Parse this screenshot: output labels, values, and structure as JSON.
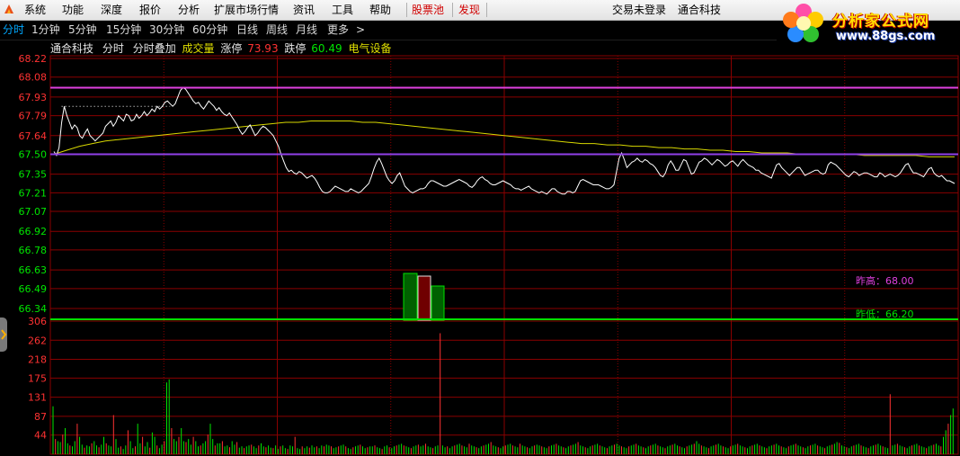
{
  "menubar": {
    "items": [
      "系统",
      "功能",
      "深度",
      "报价",
      "分析",
      "扩展市场行情",
      "资讯",
      "工具",
      "帮助"
    ],
    "highlight_items": [
      "股票池",
      "发现"
    ],
    "login_status": "交易未登录",
    "stock_title": "通合科技"
  },
  "brand": {
    "title": "分析家公式网",
    "url": "www.88gs.com"
  },
  "periodbar": {
    "items": [
      "分时",
      "1分钟",
      "5分钟",
      "15分钟",
      "30分钟",
      "60分钟",
      "日线",
      "周线",
      "月线",
      "更多"
    ],
    "active": "分时",
    "more_arrow": ">"
  },
  "infobar": {
    "stock_name": "通合科技",
    "mode": "分时",
    "overlay": "分时叠加",
    "volume_label": "成交量",
    "limit_up_label": "涨停",
    "limit_up_value": "73.93",
    "limit_down_label": "跌停",
    "limit_down_value": "60.49",
    "sector": "电气设备"
  },
  "colors": {
    "up": "#ff3232",
    "down": "#00e600",
    "grid": "#8a0000",
    "price_line": "#ffffff",
    "avg_line": "#d8d800",
    "prev_close": "#9040e8",
    "yesterday_high": "#e040e0",
    "yesterday_low": "#00e000",
    "accent": "#00a8ff"
  },
  "price_axis": {
    "ticks": [
      "68.22",
      "68.08",
      "67.93",
      "67.79",
      "67.64",
      "67.50",
      "67.35",
      "67.21",
      "67.07",
      "66.92",
      "66.78",
      "66.63",
      "66.49",
      "66.34"
    ],
    "up_ticks": 5,
    "prev_close": "67.50"
  },
  "volume_axis": {
    "ticks": [
      "306",
      "262",
      "218",
      "175",
      "131",
      "87",
      "44"
    ]
  },
  "reference_lines": {
    "yesterday_high_label": "昨高",
    "yesterday_high": "68.00",
    "yesterday_low_label": "昨低",
    "yesterday_low": "66.20"
  },
  "chart_data": {
    "type": "line",
    "prev_close": 67.5,
    "price_range": [
      66.34,
      68.22
    ],
    "volume_range": [
      0,
      306
    ],
    "price_series": [
      67.52,
      67.49,
      67.55,
      67.74,
      67.86,
      67.79,
      67.74,
      67.69,
      67.72,
      67.7,
      67.64,
      67.62,
      67.66,
      67.69,
      67.64,
      67.62,
      67.6,
      67.62,
      67.64,
      67.66,
      67.71,
      67.73,
      67.75,
      67.71,
      67.74,
      67.79,
      67.77,
      67.75,
      67.8,
      67.79,
      67.75,
      67.76,
      67.8,
      67.77,
      67.79,
      67.82,
      67.79,
      67.81,
      67.84,
      67.82,
      67.86,
      67.84,
      67.86,
      67.89,
      67.9,
      67.88,
      67.86,
      67.88,
      67.93,
      67.98,
      68.0,
      67.99,
      67.96,
      67.93,
      67.9,
      67.88,
      67.89,
      67.86,
      67.84,
      67.87,
      67.9,
      67.88,
      67.86,
      67.83,
      67.85,
      67.82,
      67.8,
      67.79,
      67.81,
      67.78,
      67.75,
      67.72,
      67.68,
      67.65,
      67.67,
      67.7,
      67.72,
      67.68,
      67.64,
      67.66,
      67.69,
      67.71,
      67.7,
      67.68,
      67.66,
      67.64,
      67.6,
      67.56,
      67.5,
      67.45,
      67.4,
      67.37,
      67.38,
      67.36,
      67.35,
      67.37,
      67.36,
      67.34,
      67.32,
      67.33,
      67.34,
      67.32,
      67.29,
      67.25,
      67.22,
      67.21,
      67.21,
      67.22,
      67.24,
      67.26,
      67.25,
      67.24,
      67.23,
      67.22,
      67.22,
      67.24,
      67.23,
      67.22,
      67.21,
      67.22,
      67.24,
      67.26,
      67.28,
      67.33,
      67.39,
      67.44,
      67.47,
      67.43,
      67.38,
      67.33,
      67.3,
      67.28,
      67.3,
      67.34,
      67.36,
      67.31,
      67.26,
      67.24,
      67.22,
      67.21,
      67.22,
      67.23,
      67.24,
      67.24,
      67.25,
      67.28,
      67.3,
      67.3,
      67.29,
      67.28,
      67.27,
      67.26,
      67.26,
      67.27,
      67.28,
      67.29,
      67.3,
      67.31,
      67.3,
      67.29,
      67.28,
      67.26,
      67.25,
      67.27,
      67.3,
      67.32,
      67.33,
      67.31,
      67.3,
      67.28,
      67.27,
      67.27,
      67.28,
      67.29,
      67.3,
      67.29,
      67.28,
      67.27,
      67.25,
      67.24,
      67.24,
      67.23,
      67.24,
      67.25,
      67.26,
      67.24,
      67.23,
      67.22,
      67.21,
      67.22,
      67.21,
      67.2,
      67.22,
      67.24,
      67.24,
      67.22,
      67.21,
      67.2,
      67.2,
      67.22,
      67.22,
      67.21,
      67.22,
      67.26,
      67.3,
      67.31,
      67.3,
      67.29,
      67.28,
      67.27,
      67.27,
      67.27,
      67.26,
      67.25,
      67.24,
      67.24,
      67.25,
      67.27,
      67.37,
      67.47,
      67.51,
      67.46,
      67.4,
      67.42,
      67.44,
      67.45,
      67.47,
      67.45,
      67.44,
      67.46,
      67.45,
      67.43,
      67.42,
      67.4,
      67.37,
      67.34,
      67.33,
      67.36,
      67.42,
      67.45,
      67.42,
      67.38,
      67.38,
      67.42,
      67.46,
      67.45,
      67.4,
      67.35,
      67.36,
      67.4,
      67.44,
      67.45,
      67.47,
      67.46,
      67.44,
      67.42,
      67.44,
      67.46,
      67.45,
      67.43,
      67.41,
      67.42,
      67.44,
      67.45,
      67.43,
      67.41,
      67.44,
      67.46,
      67.44,
      67.42,
      67.41,
      67.4,
      67.38,
      67.38,
      67.36,
      67.35,
      67.34,
      67.33,
      67.32,
      67.37,
      67.42,
      67.43,
      67.4,
      67.38,
      67.36,
      67.34,
      67.36,
      67.38,
      67.4,
      67.4,
      67.37,
      67.34,
      67.35,
      67.36,
      67.37,
      67.38,
      67.38,
      67.36,
      67.35,
      67.36,
      67.42,
      67.44,
      67.43,
      67.42,
      67.4,
      67.38,
      67.36,
      67.34,
      67.33,
      67.35,
      67.37,
      67.36,
      67.34,
      67.35,
      67.36,
      67.36,
      67.35,
      67.34,
      67.33,
      67.33,
      67.36,
      67.35,
      67.33,
      67.34,
      67.35,
      67.34,
      67.33,
      67.34,
      67.36,
      67.39,
      67.42,
      67.43,
      67.39,
      67.36,
      67.36,
      67.35,
      67.34,
      67.33,
      67.36,
      67.39,
      67.4,
      67.36,
      67.34,
      67.33,
      67.34,
      67.32,
      67.3,
      67.3,
      67.29,
      67.28
    ],
    "avg_series": [
      67.5,
      67.53,
      67.56,
      67.58,
      67.6,
      67.61,
      67.62,
      67.63,
      67.64,
      67.65,
      67.66,
      67.67,
      67.68,
      67.69,
      67.7,
      67.71,
      67.72,
      67.73,
      67.74,
      67.74,
      67.75,
      67.75,
      67.75,
      67.75,
      67.74,
      67.74,
      67.73,
      67.72,
      67.71,
      67.7,
      67.69,
      67.68,
      67.67,
      67.66,
      67.65,
      67.64,
      67.63,
      67.62,
      67.61,
      67.6,
      67.59,
      67.58,
      67.58,
      67.57,
      67.57,
      67.56,
      67.56,
      67.55,
      67.55,
      67.54,
      67.54,
      67.53,
      67.53,
      67.52,
      67.52,
      67.51,
      67.51,
      67.51,
      67.5,
      67.5,
      67.5,
      67.5,
      67.5,
      67.49,
      67.49,
      67.49,
      67.49,
      67.49,
      67.48,
      67.48,
      67.48
    ],
    "volume_up": [
      110,
      35,
      30,
      28,
      45,
      60,
      25,
      20,
      18,
      30,
      70,
      40,
      22,
      15,
      20,
      18,
      25,
      30,
      20,
      16,
      22,
      40,
      25,
      20,
      18,
      90,
      35,
      15,
      18,
      12,
      20,
      55,
      30,
      14,
      18,
      70,
      25,
      40,
      18,
      28,
      15,
      50,
      40,
      20,
      14,
      22,
      30,
      165,
      172,
      60,
      35,
      30,
      40,
      60,
      30,
      28,
      35,
      22,
      40,
      30,
      18,
      20,
      25,
      30,
      45,
      70,
      35,
      20,
      25,
      25,
      30,
      18,
      20,
      16,
      30,
      22,
      28,
      15,
      18,
      14,
      18,
      20,
      22,
      18,
      14,
      20,
      25,
      18,
      16,
      20,
      15,
      14,
      20,
      12,
      18,
      20,
      14,
      12,
      20,
      18,
      40,
      14,
      12,
      18,
      14,
      18,
      15,
      20,
      16,
      18,
      14,
      20,
      18,
      22,
      20,
      18,
      14,
      16,
      18,
      20,
      22,
      18,
      14,
      12,
      16,
      18,
      20,
      22,
      18,
      14,
      16,
      18,
      18,
      20,
      16,
      14,
      12,
      18,
      20,
      16,
      14,
      18,
      20,
      22,
      24,
      20,
      18,
      16,
      14,
      18,
      20,
      22,
      18,
      20,
      24,
      18,
      16,
      14,
      18,
      20,
      278,
      20,
      16,
      18,
      14,
      18,
      20,
      22,
      24,
      20,
      18,
      16,
      24,
      20,
      18,
      16,
      14,
      18,
      20,
      22,
      24,
      28,
      20,
      18,
      16,
      14,
      18,
      20,
      22,
      24,
      20,
      18,
      16,
      24,
      20,
      18,
      16,
      14,
      18,
      20,
      22,
      20,
      18,
      16,
      14,
      18,
      20,
      22,
      24,
      20,
      18,
      16,
      14,
      18,
      20,
      22,
      24,
      28,
      20,
      18,
      16,
      14,
      18,
      20,
      22,
      24,
      20,
      18,
      16,
      14,
      18,
      20,
      22,
      24,
      20,
      18,
      16,
      14,
      18,
      20,
      22,
      24,
      20,
      18,
      16,
      14,
      18,
      20,
      22,
      24,
      20,
      18,
      16,
      14,
      18,
      20,
      22,
      24,
      20,
      18,
      16,
      14,
      18,
      20,
      22,
      24,
      30,
      24,
      20,
      18,
      16,
      14,
      18,
      20,
      22,
      24,
      20,
      18,
      16,
      14,
      18,
      20,
      22,
      24,
      20,
      18,
      16,
      14,
      18,
      20,
      22,
      24,
      20,
      18,
      16,
      14,
      18,
      20,
      22,
      24,
      20,
      18,
      16,
      14,
      18,
      20,
      22,
      24,
      20,
      18,
      16,
      14,
      18,
      20,
      22,
      24,
      20,
      18,
      16,
      14,
      18,
      20,
      22,
      24,
      28,
      26,
      20,
      18,
      16,
      14,
      18,
      20,
      22,
      24,
      20,
      18,
      16,
      14,
      18,
      20,
      22,
      24,
      20,
      18,
      16,
      14,
      138,
      20,
      22,
      24,
      20,
      18,
      16,
      14,
      18,
      20,
      22,
      24,
      20,
      18,
      16,
      14,
      18,
      20,
      22,
      24,
      20,
      18,
      40,
      55,
      70,
      90,
      105
    ]
  }
}
